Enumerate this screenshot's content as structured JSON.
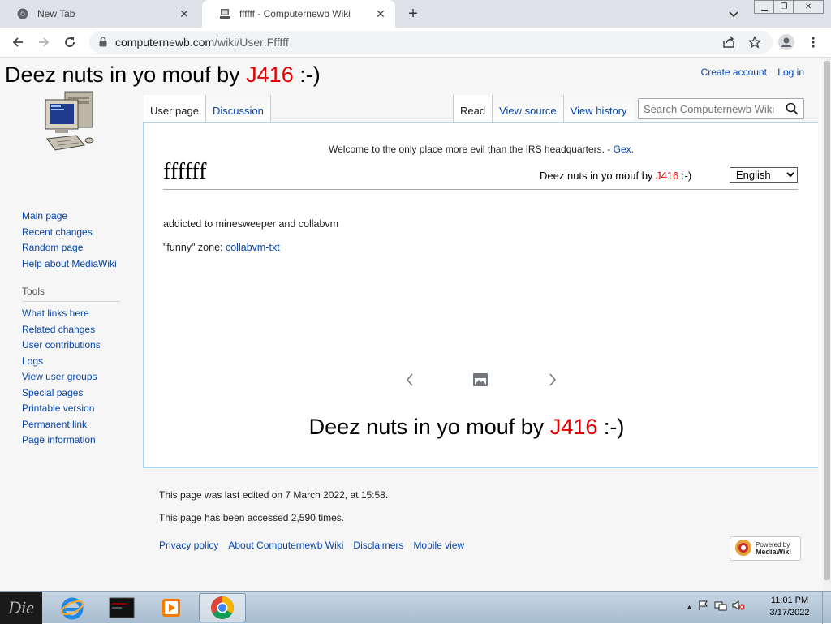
{
  "browser": {
    "tabs": [
      {
        "title": "New Tab",
        "active": false
      },
      {
        "title": "ffffff - Computernewb Wiki",
        "active": true
      }
    ],
    "new_tab_label": "+",
    "url_host": "computernewb.com",
    "url_path": "/wiki/User:Ffffff"
  },
  "site": {
    "title_prefix": "Deez nuts in yo mouf by ",
    "title_red": "J416",
    "title_suffix": " :-)"
  },
  "personal": {
    "create_account": "Create account",
    "log_in": "Log in"
  },
  "tabs_left": [
    "User page",
    "Discussion"
  ],
  "tabs_right": [
    "Read",
    "View source",
    "View history"
  ],
  "search": {
    "placeholder": "Search Computernewb Wiki"
  },
  "sidebar": {
    "navigation": [
      "Main page",
      "Recent changes",
      "Random page",
      "Help about MediaWiki"
    ],
    "tools_heading": "Tools",
    "tools": [
      "What links here",
      "Related changes",
      "User contributions",
      "Logs",
      "View user groups",
      "Special pages",
      "Printable version",
      "Permanent link",
      "Page information"
    ]
  },
  "content": {
    "sitenotice_text": "Welcome to the only place more evil than the IRS headquarters. - ",
    "sitenotice_link": "Gex.",
    "heading": "ffffff",
    "language": "English",
    "line1": "addicted to minesweeper and collabvm",
    "line2_prefix": "\"funny\" zone: ",
    "line2_link": "collabvm-txt"
  },
  "footer": {
    "last_edited": "This page was last edited on 7 March 2022, at 15:58.",
    "accessed": "This page has been accessed 2,590 times.",
    "links": [
      "Privacy policy",
      "About Computernewb Wiki",
      "Disclaimers",
      "Mobile view"
    ],
    "powered_top": "Powered by",
    "powered_bottom": "MediaWiki"
  },
  "taskbar": {
    "start_label": "Die",
    "time": "11:01 PM",
    "date": "3/17/2022"
  },
  "colors": {
    "link": "#0645ad",
    "accent_red": "#e00000",
    "content_border": "#a7d7f9"
  }
}
